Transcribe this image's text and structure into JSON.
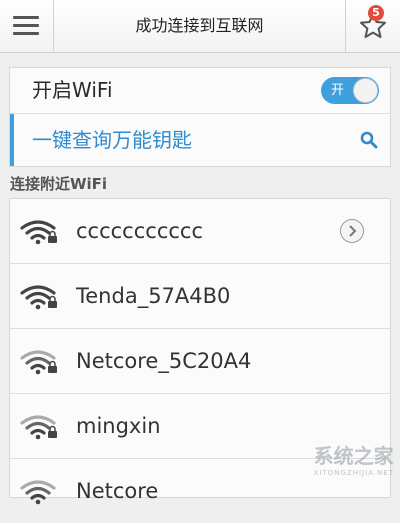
{
  "header": {
    "title": "成功连接到互联网",
    "menu_icon": "hamburger-menu-icon",
    "star_icon": "star-icon",
    "badge_count": "5"
  },
  "wifi_toggle": {
    "label": "开启WiFi",
    "switch_text": "开",
    "state": "on",
    "color": "#3ea0dd"
  },
  "key_lookup": {
    "label": "一键查询万能钥匙",
    "icon": "search-icon",
    "color": "#2f8bd0"
  },
  "nearby": {
    "header": "连接附近WiFi",
    "networks": [
      {
        "ssid": "ccccccccccc",
        "icon": "wifi-lock-icon",
        "has_arrow": true
      },
      {
        "ssid": "Tenda_57A4B0",
        "icon": "wifi-lock-icon"
      },
      {
        "ssid": "Netcore_5C20A4",
        "icon": "wifi-lock-icon"
      },
      {
        "ssid": "mingxin",
        "icon": "wifi-lock-icon"
      },
      {
        "ssid": "Netcore",
        "icon": "wifi-lock-icon"
      }
    ]
  },
  "watermark": {
    "text": "系统之家",
    "subtext": "XITONGZHIJIA.NET"
  }
}
